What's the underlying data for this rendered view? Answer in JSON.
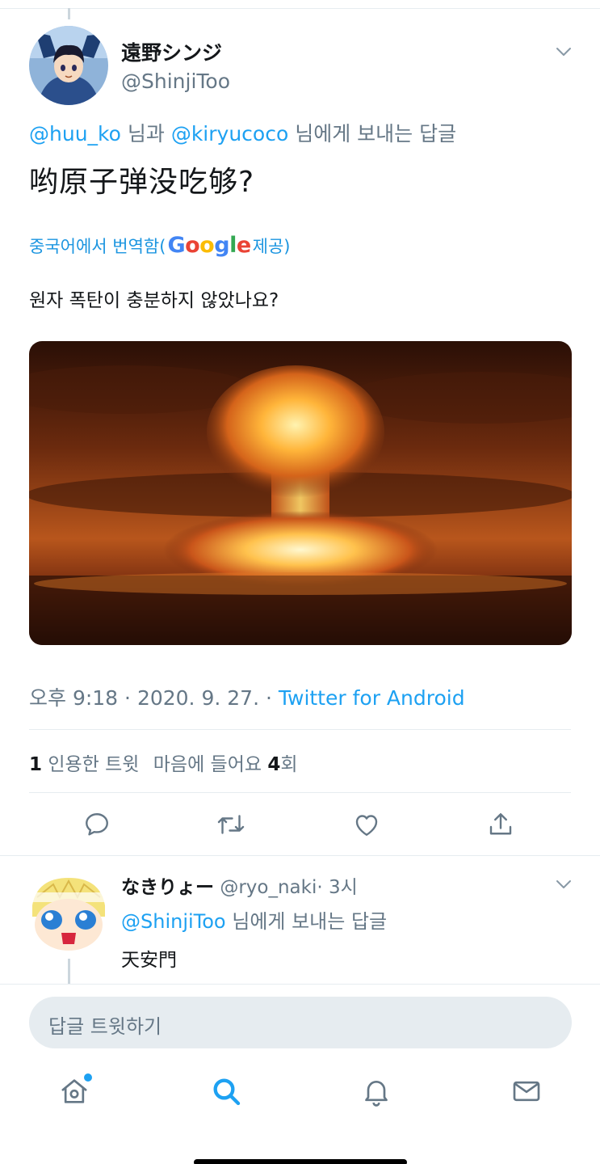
{
  "main_tweet": {
    "author_name": "遠野シンジ",
    "author_handle": "@ShinjiToo",
    "reply_to": {
      "mention_1": "@huu_ko",
      "connector": " 님과 ",
      "mention_2": "@kiryucoco",
      "suffix": " 님에게 보내는 답글"
    },
    "text": "哟原子弹没吃够?",
    "translation": {
      "prefix": "중국어에서 번역함(",
      "provider_letters": [
        "G",
        "o",
        "o",
        "g",
        "l",
        "e"
      ],
      "suffix": " 제공)",
      "text": "원자 폭탄이 충분하지 않았나요?"
    },
    "meta": {
      "time": "오후 9:18",
      "separator_1": " · ",
      "date": "2020. 9. 27.",
      "separator_2": " · ",
      "client": "Twitter for Android"
    },
    "stats": {
      "quote_count": "1",
      "quote_label": " 인용한 트윗",
      "like_label": "마음에 들어요 ",
      "like_count": "4",
      "like_suffix": "회"
    }
  },
  "reply_tweet": {
    "author_name": "なきりょー",
    "author_handle": "@ryo_naki",
    "dot": "·",
    "time": "3시",
    "reply_to_mention": "@ShinjiToo",
    "reply_to_suffix": " 님에게 보내는 답글",
    "text": "天安門"
  },
  "compose": {
    "placeholder": "답글 트윗하기"
  },
  "icons": {
    "more": "chevron-down-icon",
    "reply": "comment-icon",
    "retweet": "retweet-icon",
    "like": "heart-icon",
    "share": "share-icon",
    "nav_home": "home-icon",
    "nav_search": "search-icon",
    "nav_notifications": "bell-icon",
    "nav_messages": "mail-icon"
  },
  "colors": {
    "accent": "#1da1f2",
    "secondary_text": "#657786",
    "divider": "#e6ecf0",
    "google_blue": "#4285f4",
    "google_red": "#ea4335",
    "google_yellow": "#fbbc05",
    "google_green": "#34a853"
  }
}
